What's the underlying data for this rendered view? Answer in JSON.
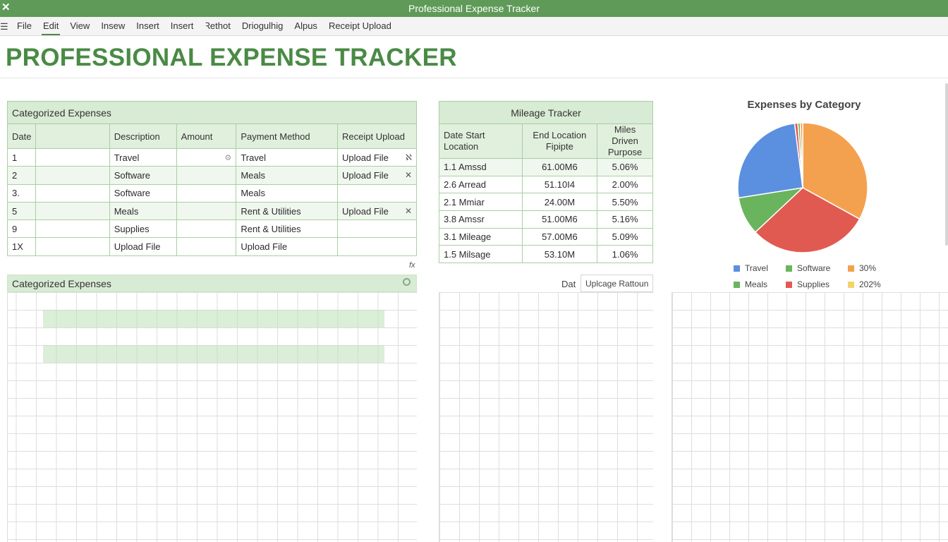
{
  "window": {
    "title": "Professional Expense Tracker",
    "close_icon": "✕"
  },
  "menu": {
    "items": [
      "File",
      "Edit",
      "View",
      "Insew",
      "Insert",
      "Insert",
      "Ꝛethot",
      "Driogulhig",
      "Alpus",
      "Receipt Upload"
    ],
    "active_index": 1
  },
  "heading": "PROFESSIONAL EXPENSE TRACKER",
  "expenses": {
    "title": "Categorized Expenses",
    "headers": [
      "Date",
      "",
      "Description",
      "Amount",
      "Payment Method",
      "Receipt Upload"
    ],
    "rows": [
      {
        "date": "1",
        "description": "Travel",
        "amount": "",
        "payment": "Travel",
        "receipt": "Upload File",
        "action": "ℵ"
      },
      {
        "date": "2",
        "description": "Software",
        "amount": "",
        "payment": "Meals",
        "receipt": "Upload File",
        "action": "✕"
      },
      {
        "date": "3.",
        "description": "Software",
        "amount": "",
        "payment": "Meals",
        "receipt": "",
        "action": ""
      },
      {
        "date": "5",
        "description": "Meals",
        "amount": "",
        "payment": "Rent & Utilities",
        "receipt": "Upload File",
        "action": "✕"
      },
      {
        "date": "9",
        "description": "Supplies",
        "amount": "",
        "payment": "Rent & Utilities",
        "receipt": "",
        "action": ""
      },
      {
        "date": "1X",
        "description": "Upload File",
        "amount": "",
        "payment": "Upload File",
        "receipt": "",
        "action": ""
      }
    ]
  },
  "section2": {
    "title": "Categorized Expenses",
    "fx": "fx"
  },
  "mileage": {
    "title": "Mileage Tracker",
    "headers": [
      "Date  Start Location",
      "End Location Fipipte",
      "Miles Driven Purpose"
    ],
    "rows": [
      [
        "1.1 Amssd",
        "61.00M6",
        "5.06%"
      ],
      [
        "2.6 Arread",
        "51.10I4",
        "2.00%"
      ],
      [
        "2.1 Mmiar",
        "24.00M",
        "5.50%"
      ],
      [
        "3.8 Amssr",
        "51.00M6",
        "5.16%"
      ],
      [
        "3.1 Mileage",
        "57.00M6",
        "5.09%"
      ],
      [
        "1.5 Milsage",
        "53.10M",
        "1.06%"
      ]
    ],
    "dat_label": "Dat",
    "input_value": "Uplcage Rattoun"
  },
  "chart_data": {
    "type": "pie",
    "title": "Expenses by Category",
    "slices": [
      {
        "color": "#f4a14f",
        "value": 33
      },
      {
        "color": "#e15a52",
        "value": 30
      },
      {
        "color": "#6ab45e",
        "value": 9.5
      },
      {
        "color": "#5b8fe0",
        "value": 25.5
      },
      {
        "color": "#e15a52",
        "value": 0.8
      },
      {
        "color": "#6ab45e",
        "value": 0.6
      },
      {
        "color": "#f4a14f",
        "value": 0.6
      }
    ],
    "legend": [
      {
        "label": "Travel",
        "color": "#5b8fe0"
      },
      {
        "label": "Software",
        "color": "#6ab45e"
      },
      {
        "label": "30%",
        "color": "#f4a14f"
      },
      {
        "label": "Meals",
        "color": "#6ab45e"
      },
      {
        "label": "Supplies",
        "color": "#e15a52"
      },
      {
        "label": "202%",
        "color": "#f2d36b"
      }
    ]
  }
}
